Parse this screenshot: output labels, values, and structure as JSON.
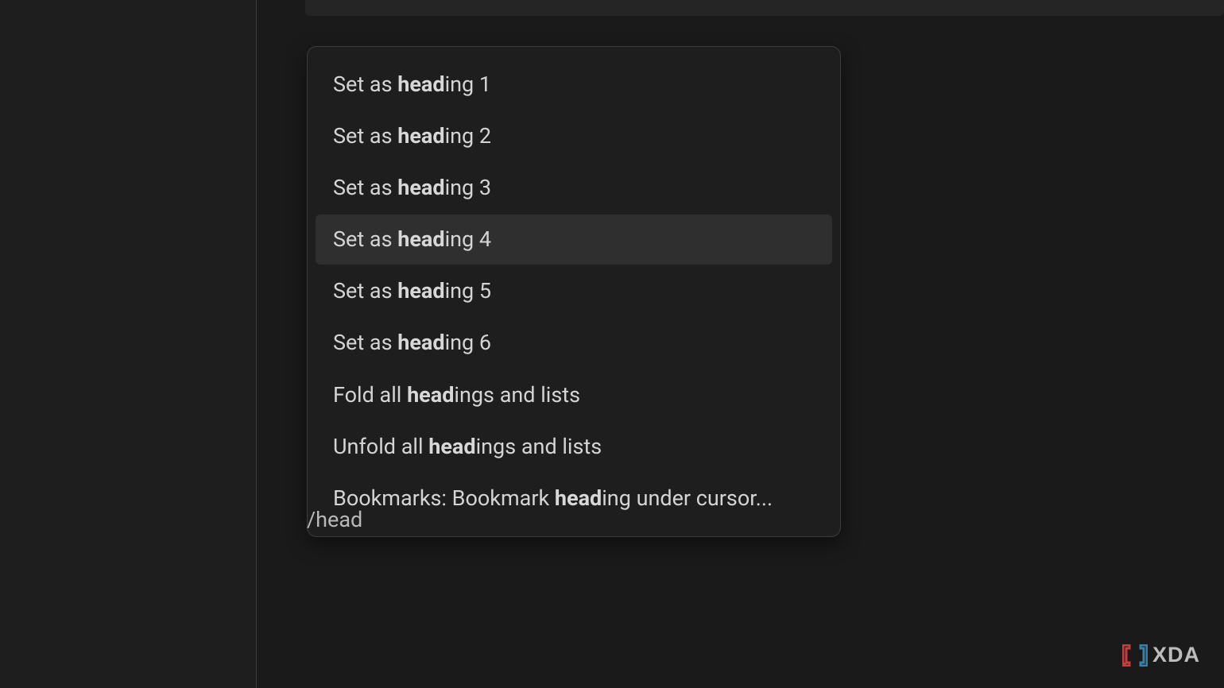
{
  "commands": [
    {
      "before": "Set as ",
      "match": "head",
      "after": "ing 1",
      "highlighted": false
    },
    {
      "before": "Set as ",
      "match": "head",
      "after": "ing 2",
      "highlighted": false
    },
    {
      "before": "Set as ",
      "match": "head",
      "after": "ing 3",
      "highlighted": false
    },
    {
      "before": "Set as ",
      "match": "head",
      "after": "ing 4",
      "highlighted": true
    },
    {
      "before": "Set as ",
      "match": "head",
      "after": "ing 5",
      "highlighted": false
    },
    {
      "before": "Set as ",
      "match": "head",
      "after": "ing 6",
      "highlighted": false
    },
    {
      "before": "Fold all ",
      "match": "head",
      "after": "ings and lists",
      "highlighted": false
    },
    {
      "before": "Unfold all ",
      "match": "head",
      "after": "ings and lists",
      "highlighted": false
    },
    {
      "before": "Bookmarks: Bookmark ",
      "match": "head",
      "after": "ing under cursor...",
      "highlighted": false
    }
  ],
  "slash_input": "/head",
  "watermark": "XDA"
}
